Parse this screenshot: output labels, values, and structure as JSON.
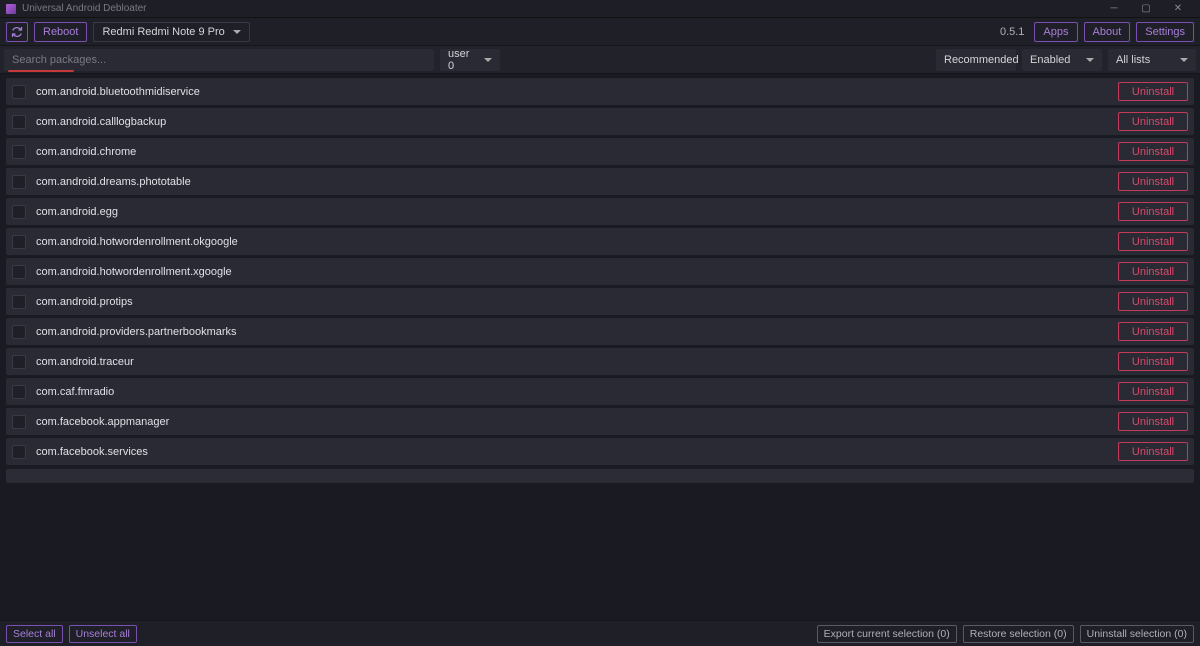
{
  "window": {
    "title": "Universal Android Debloater"
  },
  "toolbar": {
    "reboot_label": "Reboot",
    "device": "Redmi Redmi Note 9 Pro",
    "version": "0.5.1",
    "apps_label": "Apps",
    "about_label": "About",
    "settings_label": "Settings"
  },
  "filters": {
    "search_placeholder": "Search packages...",
    "user": "user 0",
    "recommendation": "Recommended",
    "status": "Enabled",
    "list": "All lists"
  },
  "action_label": "Uninstall",
  "packages": [
    {
      "name": "com.android.bluetoothmidiservice"
    },
    {
      "name": "com.android.calllogbackup"
    },
    {
      "name": "com.android.chrome"
    },
    {
      "name": "com.android.dreams.phototable"
    },
    {
      "name": "com.android.egg"
    },
    {
      "name": "com.android.hotwordenrollment.okgoogle"
    },
    {
      "name": "com.android.hotwordenrollment.xgoogle"
    },
    {
      "name": "com.android.protips"
    },
    {
      "name": "com.android.providers.partnerbookmarks"
    },
    {
      "name": "com.android.traceur"
    },
    {
      "name": "com.caf.fmradio"
    },
    {
      "name": "com.facebook.appmanager"
    },
    {
      "name": "com.facebook.services"
    }
  ],
  "bottom": {
    "select_all": "Select all",
    "unselect_all": "Unselect all",
    "export": "Export current selection (0)",
    "restore": "Restore selection (0)",
    "uninstall": "Uninstall selection (0)"
  }
}
